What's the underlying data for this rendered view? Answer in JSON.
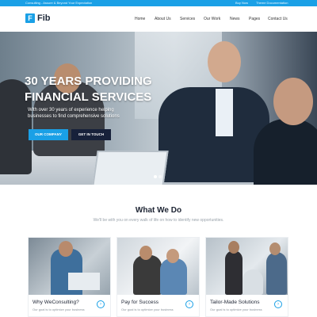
{
  "topbar": {
    "left_text": "Consulting - Assure & Beyond Your Expectation",
    "right_1": "Buy Now",
    "right_2": "Theme Documentation"
  },
  "brand": {
    "logo_letter": "F",
    "name": "Fib"
  },
  "nav": [
    "Home",
    "About Us",
    "Services",
    "Our Work",
    "News",
    "Pages",
    "Contact Us"
  ],
  "hero": {
    "title_line1": "30 YEARS PROVIDING",
    "title_line2": "FINANCIAL SERVICES",
    "subtitle": "With over 30 years of experience helping businesses to find comprehensive solutions",
    "btn_company": "OUR COMPANY",
    "btn_touch": "GET IN TOUCH",
    "slides": 2,
    "active_slide": 1
  },
  "section": {
    "title": "What We Do",
    "subtitle": "We'll be with you on every walk of life on how to identify new opportunities."
  },
  "cards": [
    {
      "title": "Why WeConsulting?",
      "desc": "Our goal is to optimize your business",
      "icon": "arrow-right-icon"
    },
    {
      "title": "Pay for Success",
      "desc": "Our goal is to optimize your business",
      "icon": "arrow-right-icon"
    },
    {
      "title": "Tailor-Made Solutions",
      "desc": "Our goal is to optimize your business",
      "icon": "arrow-right-icon"
    }
  ],
  "colors": {
    "accent": "#1aa0e6",
    "dark": "#17213a"
  }
}
